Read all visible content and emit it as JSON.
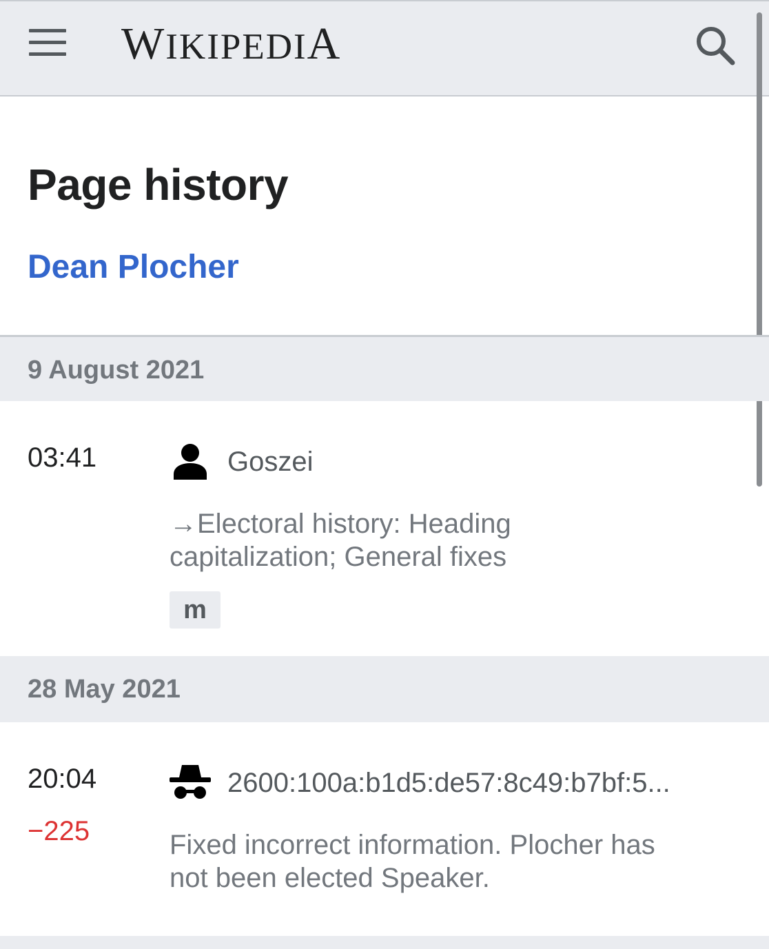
{
  "header": {
    "menu_icon": "hamburger-menu-icon",
    "wordmark": {
      "w": "W",
      "ikipedi": "IKIPEDI",
      "a": "A"
    },
    "search_icon": "search-icon"
  },
  "page": {
    "title": "Page history",
    "article": "Dean Plocher"
  },
  "groups": [
    {
      "date": "9 August 2021",
      "entries": [
        {
          "time": "03:41",
          "user_icon": "user-icon",
          "user": "Goszei",
          "comment_line1": "→Electoral history: Heading",
          "comment_line2": "capitalization; General fixes",
          "tag": "m"
        }
      ]
    },
    {
      "date": "28 May 2021",
      "entries": [
        {
          "time": "20:04",
          "bytes": "−225",
          "user_icon": "anonymous-user-icon",
          "user": "2600:100a:b1d5:de57:8c49:b7bf:5...",
          "comment_line1": "Fixed incorrect information. Plocher has",
          "comment_line2": "not been elected Speaker."
        }
      ]
    }
  ],
  "colors": {
    "header_bg": "#eaecf0",
    "link": "#3366cc",
    "negative": "#dd3333",
    "muted_text": "#72777d"
  }
}
